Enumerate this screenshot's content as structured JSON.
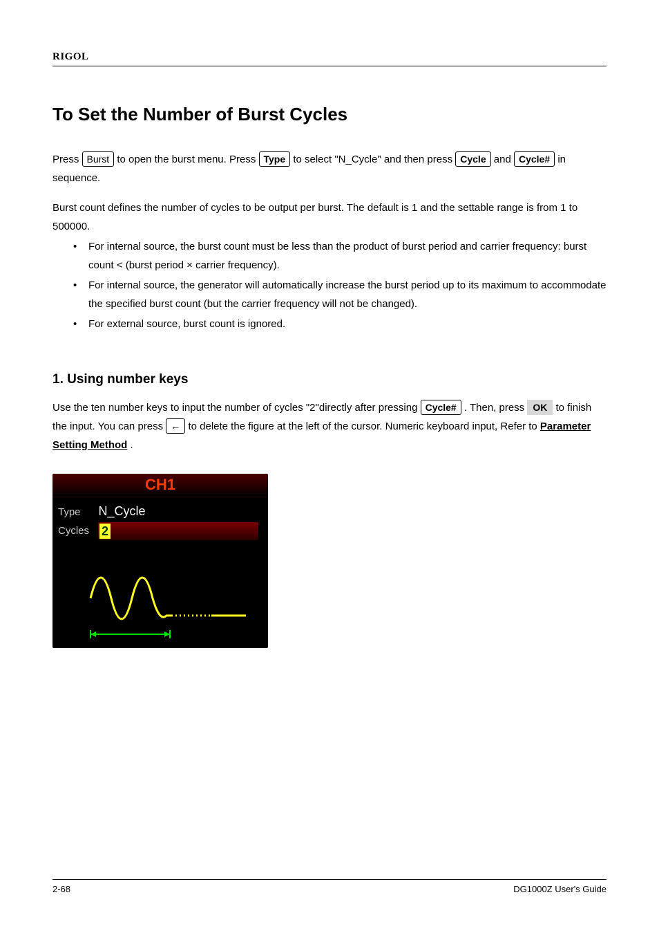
{
  "header": {
    "brand": "RIGOL"
  },
  "title": "To Set the Number of Burst Cycles",
  "p1_a": "Press ",
  "p1_key1": "Burst",
  "p1_b": " to open the burst menu. Press ",
  "p1_key2": "Type",
  "p1_c": " to select \"N_Cycle\" and then press ",
  "p1_key3": "Cycle",
  "p1_d": " and ",
  "p1_key4": "Cycle#",
  "p1_e": " in sequence.",
  "p2": "Burst count defines the number of cycles to be output per burst. The default is 1 and the settable range is from 1 to 500000.",
  "li1": "For internal source, the burst count must be less than the product of burst period and carrier frequency: burst count < (burst period × carrier frequency).",
  "li2": "For internal source, the generator will automatically increase the burst period up to its maximum to accommodate the specified burst count (but the carrier frequency will not be changed).",
  "li3": "For external source, burst count is ignored.",
  "subhead": "1. Using number keys",
  "p3_a": "Use the ten number keys to input the number of cycles \"2\"directly after pressing ",
  "p3_key1": "Cycle#",
  "p3_b": ". Then, press ",
  "p3_soft1": "OK",
  "p3_c": " to finish the input. You can press ",
  "p3_key2": "←",
  "p3_d": " to delete the figure at the left of the cursor. Numeric keyboard input, Refer to ",
  "p3_link": "Parameter Setting Method",
  "p3_e": ".",
  "lcd": {
    "title": "CH1",
    "type_label": "Type",
    "type_value": "N_Cycle",
    "cycles_label": "Cycles",
    "cycles_value": "2"
  },
  "footer": {
    "page": "2-68",
    "doc": "DG1000Z User's Guide"
  }
}
